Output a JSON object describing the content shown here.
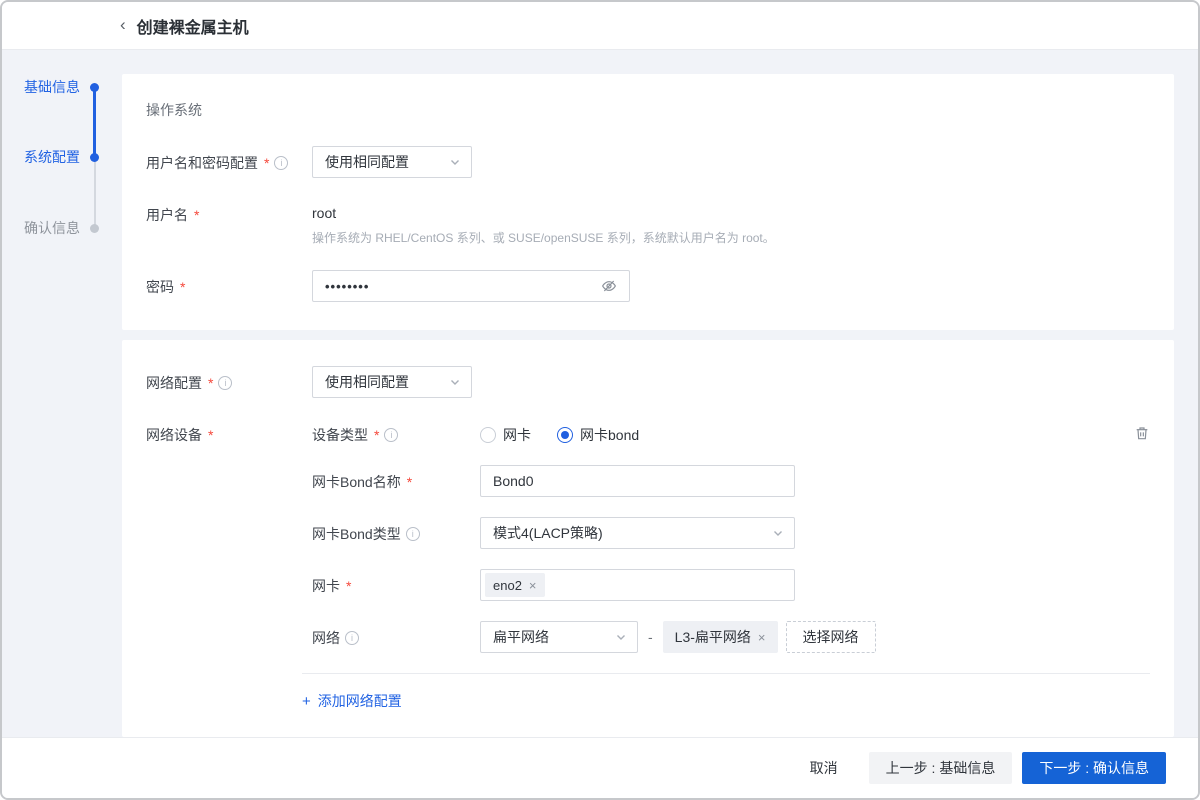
{
  "header": {
    "back_icon": "‹",
    "title": "创建裸金属主机"
  },
  "icons": {
    "info": "i",
    "close": "×",
    "plus": "+",
    "dash": "-"
  },
  "marks": {
    "required": "*"
  },
  "sidebar": {
    "steps": [
      {
        "label": "基础信息",
        "state": "done"
      },
      {
        "label": "系统配置",
        "state": "active"
      },
      {
        "label": "确认信息",
        "state": "pending"
      }
    ]
  },
  "os_section": {
    "title": "操作系统",
    "credential_config": {
      "label": "用户名和密码配置",
      "value": "使用相同配置"
    },
    "username": {
      "label": "用户名",
      "value": "root",
      "hint": "操作系统为 RHEL/CentOS 系列、或 SUSE/openSUSE 系列，系统默认用户名为 root。"
    },
    "password": {
      "label": "密码",
      "masked_value": "••••••••"
    }
  },
  "network_section": {
    "network_config": {
      "label": "网络配置",
      "value": "使用相同配置"
    },
    "network_device": {
      "label": "网络设备"
    },
    "device_type": {
      "label": "设备类型",
      "options": [
        {
          "label": "网卡",
          "selected": false
        },
        {
          "label": "网卡bond",
          "selected": true
        }
      ]
    },
    "bond_name": {
      "label": "网卡Bond名称",
      "value": "Bond0"
    },
    "bond_type": {
      "label": "网卡Bond类型",
      "value": "模式4(LACP策略)"
    },
    "nic": {
      "label": "网卡",
      "tags": [
        "eno2"
      ]
    },
    "network": {
      "label": "网络",
      "type_value": "扁平网络",
      "tag": "L3-扁平网络",
      "select_button": "选择网络"
    },
    "add_label": "添加网络配置"
  },
  "footer": {
    "cancel": "取消",
    "prev": "上一步 : 基础信息",
    "next": "下一步 : 确认信息"
  },
  "colors": {
    "accent": "#1563d6",
    "link": "#2263e3",
    "danger": "#f5483b",
    "page_bg": "#f1f3f8"
  }
}
